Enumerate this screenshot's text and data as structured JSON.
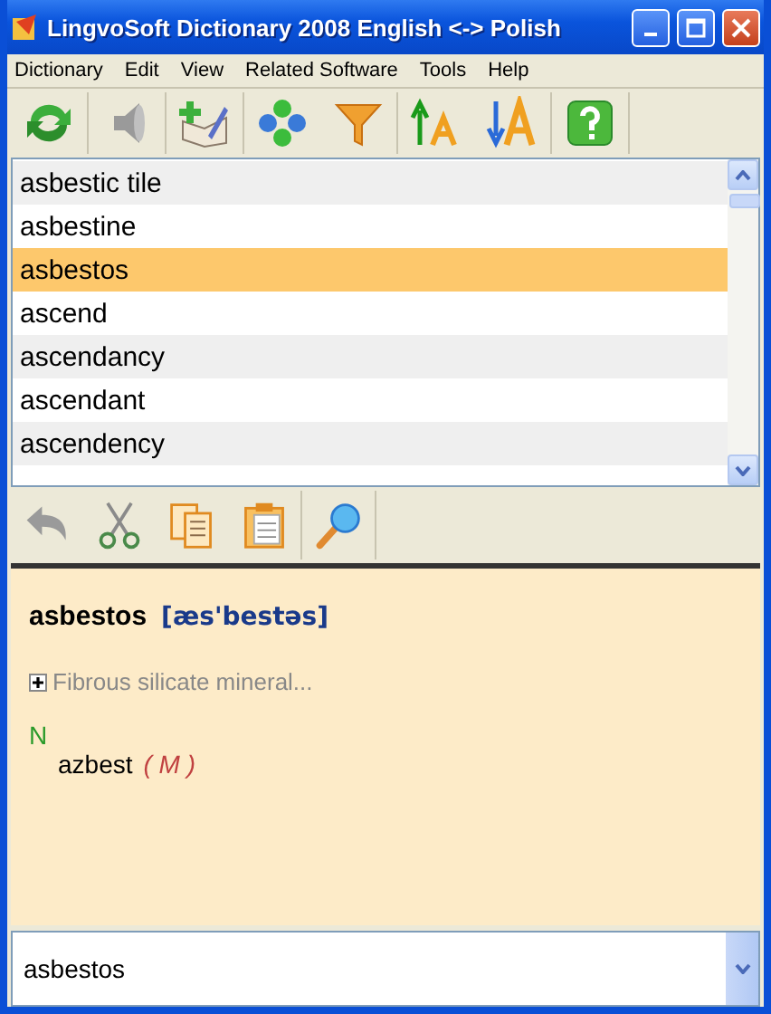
{
  "window": {
    "title": "LingvoSoft Dictionary 2008 English <-> Polish"
  },
  "menu": [
    "Dictionary",
    "Edit",
    "View",
    "Related Software",
    "Tools",
    "Help"
  ],
  "word_list": [
    {
      "text": "asbestic tile",
      "selected": false
    },
    {
      "text": "asbestine",
      "selected": false
    },
    {
      "text": "asbestos",
      "selected": true
    },
    {
      "text": "ascend",
      "selected": false
    },
    {
      "text": "ascendancy",
      "selected": false
    },
    {
      "text": "ascendant",
      "selected": false
    },
    {
      "text": "ascendency",
      "selected": false
    }
  ],
  "entry": {
    "headword": "asbestos",
    "transcription": "[æs'bestəs]",
    "summary": {
      "text": "Fibrous silicate mineral...",
      "expanded": false
    },
    "part_of_speech": "N",
    "translations": [
      {
        "word": "azbest",
        "gender": "( M )"
      }
    ]
  },
  "search": {
    "value": "asbestos"
  }
}
